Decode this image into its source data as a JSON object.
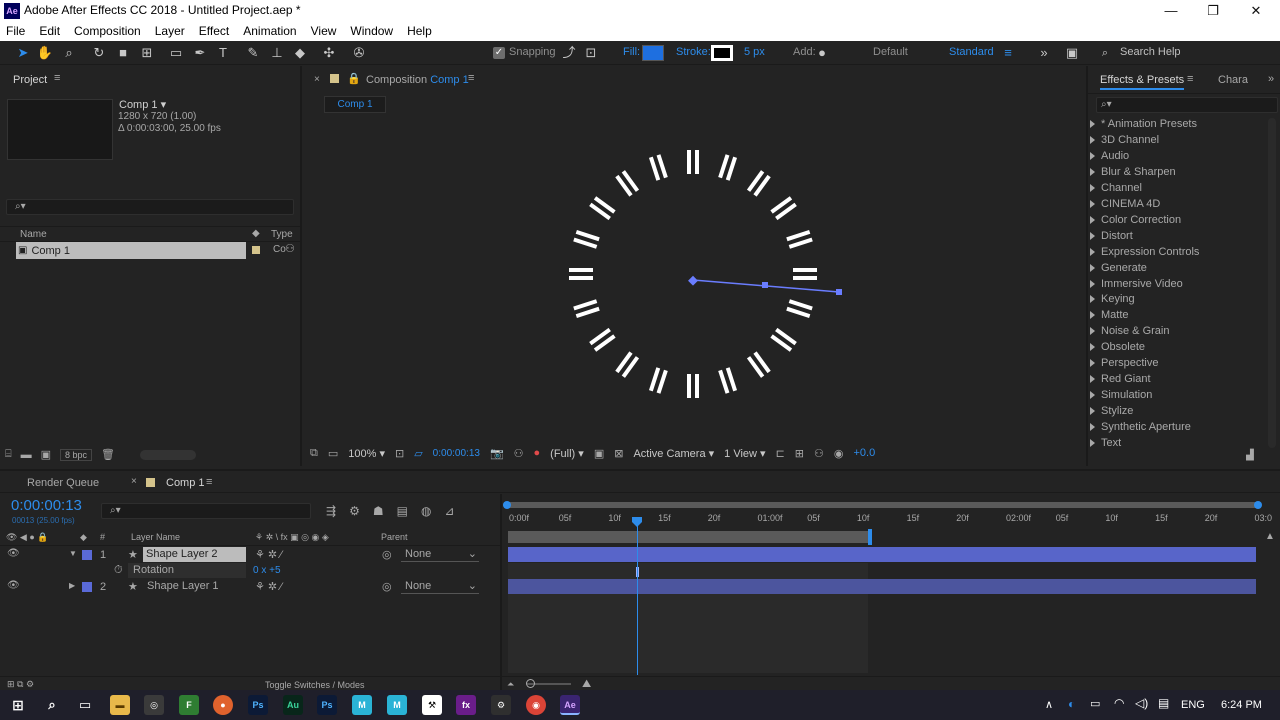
{
  "window": {
    "title": "Adobe After Effects CC 2018 - Untitled Project.aep *",
    "logo": "Ae",
    "minimize": "—",
    "maximize": "❐",
    "close": "✕"
  },
  "menu": [
    "File",
    "Edit",
    "Composition",
    "Layer",
    "Effect",
    "Animation",
    "View",
    "Window",
    "Help"
  ],
  "toolbar": {
    "snapping": "Snapping",
    "fill": "Fill:",
    "stroke": "Stroke:",
    "stroke_px": "5 px",
    "add": "Add:",
    "default_ws": "Default",
    "standard_ws": "Standard",
    "search_help": "Search Help"
  },
  "project": {
    "title": "Project",
    "comp_name": "Comp 1",
    "comp_size": "1280 x 720 (1.00)",
    "comp_duration": "Δ 0:00:03:00, 25.00 fps",
    "col_name": "Name",
    "col_type": "Type",
    "item": "Comp 1",
    "item_type": "Co",
    "bpc": "8 bpc"
  },
  "composition": {
    "panel_label": "Composition",
    "comp_link": "Comp 1",
    "tab": "Comp 1",
    "zoom": "100%",
    "timecode": "0:00:00:13",
    "resolution": "(Full)",
    "camera": "Active Camera",
    "views": "1 View",
    "exposure": "+0.0"
  },
  "effects": {
    "title": "Effects & Presets",
    "other_tab": "Chara",
    "items": [
      "* Animation Presets",
      "3D Channel",
      "Audio",
      "Blur & Sharpen",
      "Channel",
      "CINEMA 4D",
      "Color Correction",
      "Distort",
      "Expression Controls",
      "Generate",
      "Immersive Video",
      "Keying",
      "Matte",
      "Noise & Grain",
      "Obsolete",
      "Perspective",
      "Red Giant",
      "Simulation",
      "Stylize",
      "Synthetic Aperture",
      "Text"
    ]
  },
  "timeline": {
    "render_queue": "Render Queue",
    "comp_tab": "Comp 1",
    "timecode": "0:00:00:13",
    "timecode_sub": "00013 (25.00 fps)",
    "col_layer_name": "Layer Name",
    "col_parent": "Parent",
    "col_num": "#",
    "layers": [
      {
        "num": "1",
        "name": "Shape Layer 2",
        "parent": "None"
      },
      {
        "num": "2",
        "name": "Shape Layer 1",
        "parent": "None"
      }
    ],
    "rotation_label": "Rotation",
    "rotation_value": "0 x +5",
    "ruler": [
      "0:00f",
      "05f",
      "10f",
      "15f",
      "20f",
      "01:00f",
      "05f",
      "10f",
      "15f",
      "20f",
      "02:00f",
      "05f",
      "10f",
      "15f",
      "20f",
      "03:0"
    ],
    "toggle": "Toggle Switches / Modes"
  },
  "taskbar": {
    "lang": "ENG",
    "time": "6:24 PM"
  }
}
